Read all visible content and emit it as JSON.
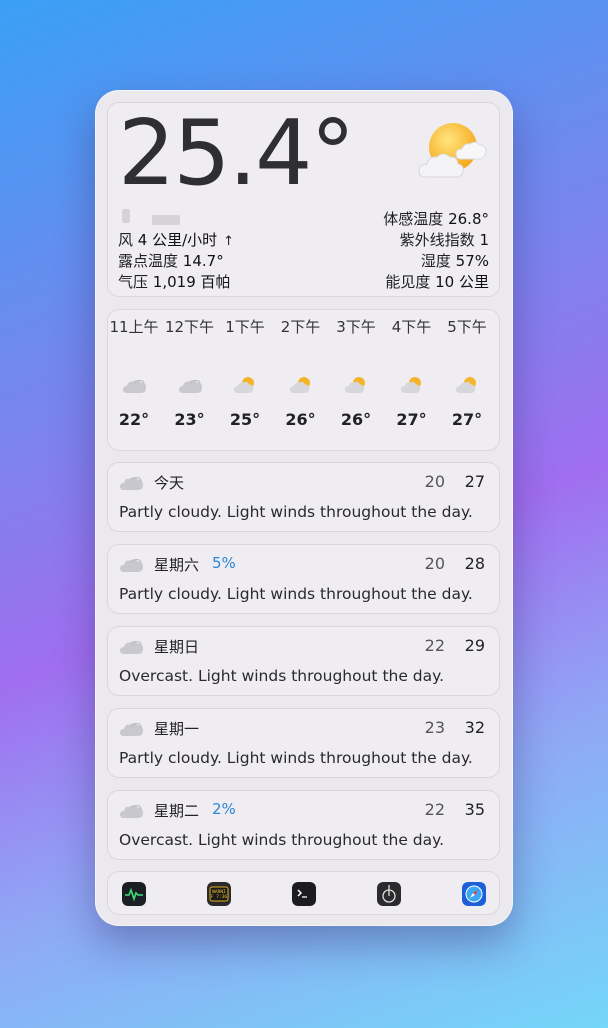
{
  "current": {
    "temperature": "25.4°",
    "icon": "partly-sunny-icon",
    "wind_label": "风",
    "wind_value": "4 公里/小时",
    "wind_arrow": "↑",
    "dew_label": "露点温度",
    "dew_value": "14.7°",
    "pressure_label": "气压",
    "pressure_value": "1,019 百帕",
    "feels_label": "体感温度",
    "feels_value": "26.8°",
    "uv_label": "紫外线指数",
    "uv_value": "1",
    "humidity_label": "湿度",
    "humidity_value": "57%",
    "visibility_label": "能见度",
    "visibility_value": "10 公里"
  },
  "hourly": [
    {
      "time": "11上午",
      "icon": "cloud-icon",
      "temp": "22°"
    },
    {
      "time": "12下午",
      "icon": "cloud-icon",
      "temp": "23°"
    },
    {
      "time": "1下午",
      "icon": "partly-sunny-icon",
      "temp": "25°"
    },
    {
      "time": "2下午",
      "icon": "partly-sunny-icon",
      "temp": "26°"
    },
    {
      "time": "3下午",
      "icon": "partly-sunny-icon",
      "temp": "26°"
    },
    {
      "time": "4下午",
      "icon": "partly-sunny-icon",
      "temp": "27°"
    },
    {
      "time": "5下午",
      "icon": "partly-sunny-icon",
      "temp": "27°"
    }
  ],
  "daily": [
    {
      "name": "今天",
      "precip": "",
      "low": "20",
      "high": "27",
      "desc": "Partly cloudy. Light winds throughout the day."
    },
    {
      "name": "星期六",
      "precip": "5%",
      "low": "20",
      "high": "28",
      "desc": "Partly cloudy. Light winds throughout the day."
    },
    {
      "name": "星期日",
      "precip": "",
      "low": "22",
      "high": "29",
      "desc": "Overcast. Light winds throughout the day."
    },
    {
      "name": "星期一",
      "precip": "",
      "low": "23",
      "high": "32",
      "desc": "Partly cloudy. Light winds throughout the day."
    },
    {
      "name": "星期二",
      "precip": "2%",
      "low": "22",
      "high": "35",
      "desc": "Overcast. Light winds throughout the day."
    }
  ],
  "dock": {
    "apps": [
      "activity-monitor-icon",
      "console-warning-icon",
      "terminal-icon",
      "instruments-icon",
      "safari-icon"
    ],
    "console_badge": "WARNI\nF 7:36"
  },
  "colors": {
    "precip": "#2a86d8",
    "window_bg": "#ebe9ee",
    "card_bg": "#efedf1"
  }
}
